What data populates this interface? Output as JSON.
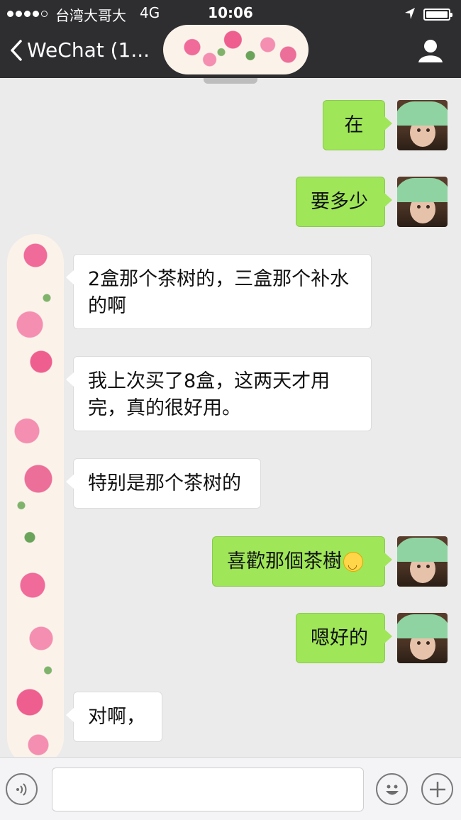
{
  "status_bar": {
    "carrier": "台湾大哥大",
    "network": "4G",
    "time": "10:06"
  },
  "nav": {
    "back_label": "WeChat (1..."
  },
  "messages": [
    {
      "side": "sent",
      "text": "在"
    },
    {
      "side": "sent",
      "text": "要多少"
    },
    {
      "side": "received",
      "text": "2盒那个茶树的，三盒那个补水的啊"
    },
    {
      "side": "received",
      "text": "我上次买了8盒，这两天才用完，真的很好用。"
    },
    {
      "side": "received",
      "text": "特别是那个茶树的"
    },
    {
      "side": "sent",
      "text": "喜歡那個茶樹",
      "emoji": "smiley-emoji"
    },
    {
      "side": "sent",
      "text": "嗯好的"
    },
    {
      "side": "received",
      "text": "对啊，"
    }
  ],
  "colors": {
    "header_bg": "#2e2e31",
    "chat_bg": "#ebebeb",
    "sent_bubble": "#9fe658",
    "received_bubble": "#ffffff"
  },
  "icons": [
    "back-chevron-icon",
    "location-arrow-icon",
    "battery-icon",
    "contact-profile-icon",
    "voice-input-icon",
    "emoji-icon",
    "plus-icon"
  ]
}
